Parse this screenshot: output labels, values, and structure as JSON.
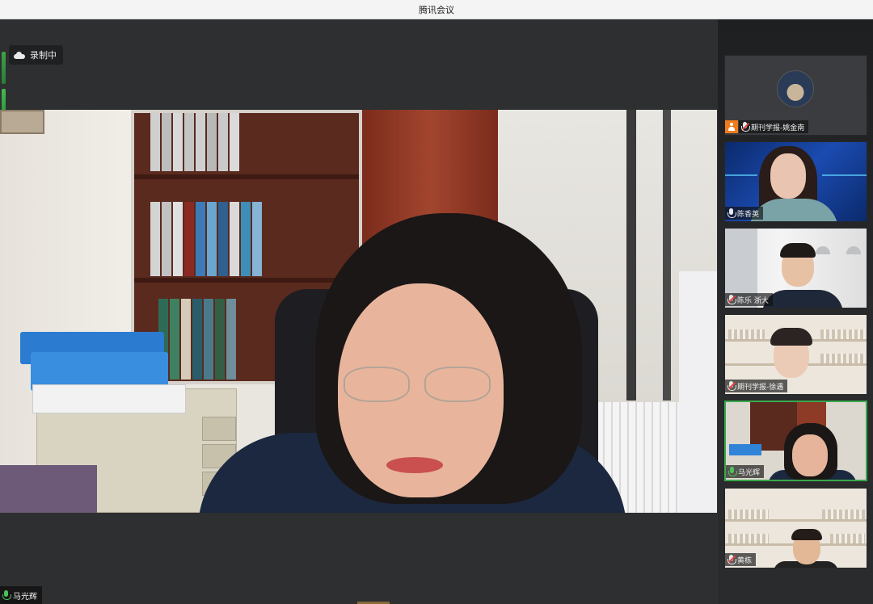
{
  "window": {
    "title": "腾讯会议"
  },
  "recording": {
    "label": "录制中"
  },
  "main_speaker": {
    "name": "马光辉"
  },
  "participants": [
    {
      "name": "期刊学报-姚金南",
      "host": true,
      "mic": "muted"
    },
    {
      "name": "陈香英",
      "host": false,
      "mic": "active"
    },
    {
      "name": "陈乐 浙大",
      "host": false,
      "mic": "muted"
    },
    {
      "name": "期刊学报-徐遇",
      "host": false,
      "mic": "muted"
    },
    {
      "name": "马光辉",
      "host": false,
      "mic": "active",
      "speaking": true
    },
    {
      "name": "黄栋",
      "host": false,
      "mic": "muted"
    }
  ],
  "colors": {
    "accent_green": "#3aa84a",
    "host_orange": "#f07c1e",
    "mute_red": "#e54242"
  },
  "icons": [
    "cloud-icon",
    "mic-icon",
    "mic-muted-icon",
    "host-icon",
    "audio-level-icon"
  ]
}
